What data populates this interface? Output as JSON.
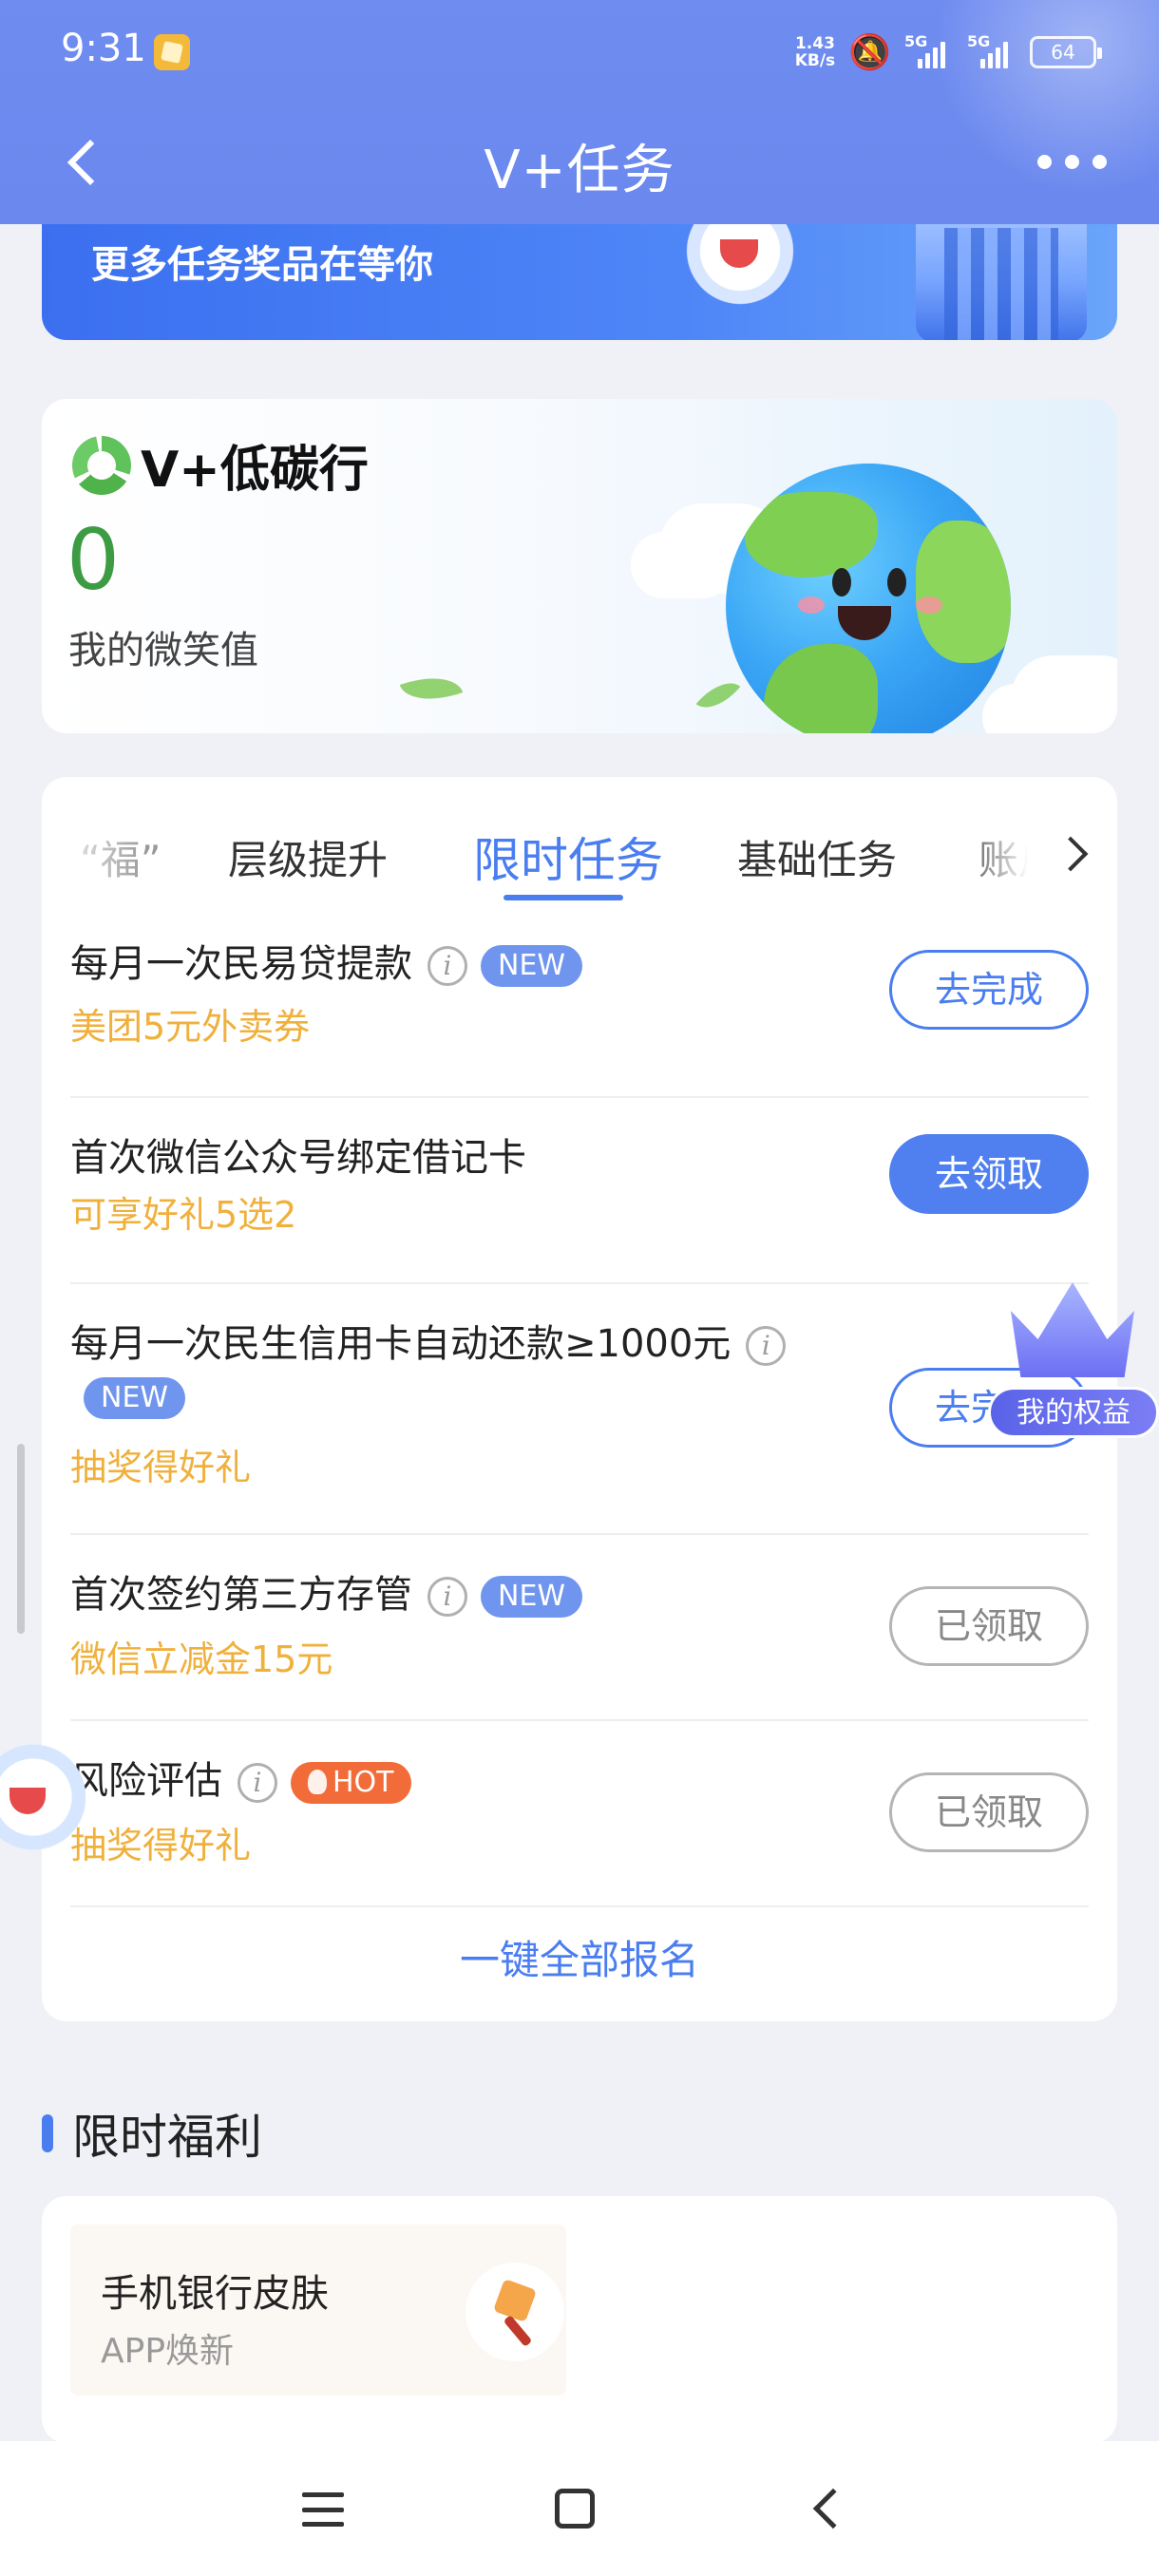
{
  "status_bar": {
    "time": "9:31",
    "net_speed_value": "1.43",
    "net_speed_unit": "KB/s",
    "signal1": "5G",
    "signal2": "5G",
    "battery": "64"
  },
  "nav": {
    "title": "V+任务"
  },
  "banner": {
    "text": "更多任务奖品在等你"
  },
  "carbon": {
    "title": "V+低碳行",
    "smile_value": "0",
    "smile_label": "我的微笑值"
  },
  "tabs": {
    "items": [
      "“福”",
      "层级提升",
      "限时任务",
      "基础任务",
      "账户"
    ],
    "active_index": 2
  },
  "tasks": [
    {
      "title": "每月一次民易贷提款",
      "reward": "美团5元外卖券",
      "badge": "NEW",
      "button": "去完成",
      "button_style": "outline-blue"
    },
    {
      "title": "首次微信公众号绑定借记卡",
      "reward": "可享好礼5选2",
      "badge": "",
      "button": "去领取",
      "button_style": "solid-blue"
    },
    {
      "title": "每月一次民生信用卡自动还款≥1000元",
      "reward": "抽奖得好礼",
      "badge": "NEW",
      "button": "去完成",
      "button_style": "outline-blue"
    },
    {
      "title": "首次签约第三方存管",
      "reward": "微信立减金15元",
      "badge": "NEW",
      "button": "已领取",
      "button_style": "outline-gray"
    },
    {
      "title": "风险评估",
      "reward": "抽奖得好礼",
      "badge": "HOT",
      "button": "已领取",
      "button_style": "outline-gray"
    }
  ],
  "signup_all": "一键全部报名",
  "section": {
    "title": "限时福利"
  },
  "benefits": [
    {
      "name": "手机银行皮肤",
      "sub": "APP焕新"
    }
  ],
  "float_rights": {
    "label": "我的权益"
  },
  "colors": {
    "header": "#6f8cf0",
    "accent": "#4a7ef0",
    "reward": "#f0b03c",
    "badge_new": "#6f95ee",
    "badge_hot": "#f26c3a",
    "smile_value": "#3d9b44"
  },
  "icons": [
    "back-icon",
    "more-icon",
    "recycle-icon",
    "info-icon",
    "chevron-right-icon",
    "crown-icon",
    "magic-wand-icon",
    "menu-icon",
    "home-icon",
    "nav-back-icon"
  ]
}
